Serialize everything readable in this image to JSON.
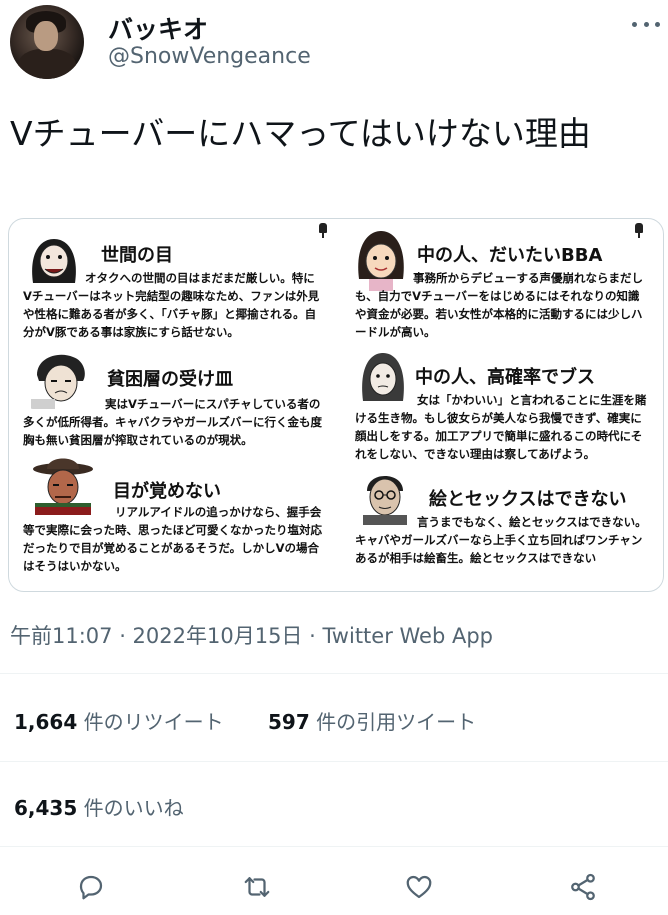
{
  "user": {
    "display_name": "バッキオ",
    "handle": "@SnowVengeance"
  },
  "tweet": {
    "text": "Vチューバーにハマってはいけない理由",
    "meta": "午前11:07 · 2022年10月15日 · Twitter Web App"
  },
  "media": {
    "cells": [
      {
        "title": "世間の目",
        "body": "オタクへの世間の目はまだまだ厳しい。特にVチューバーはネット完結型の趣味なため、ファンは外見や性格に難ある者が多く、「バチャ豚」と揶揄される。自分がV豚である事は家族にすら話せない。"
      },
      {
        "title": "中の人、だいたいBBA",
        "body": "事務所からデビューする声優崩れならまだしも、自力でVチューバーをはじめるにはそれなりの知識や資金が必要。若い女性が本格的に活動するには少しハードルが高い。"
      },
      {
        "title": "貧困層の受け皿",
        "body": "実はVチューバーにスパチャしている者の多くが低所得者。キャバクラやガールズバーに行く金も度胸も無い貧困層が搾取されているのが現状。"
      },
      {
        "title": "中の人、高確率でブス",
        "body": "女は「かわいい」と言われることに生涯を賭ける生き物。もし彼女らが美人なら我慢できず、確実に顔出しをする。加工アプリで簡単に盛れるこの時代にそれをしない、できない理由は察してあげよう。"
      },
      {
        "title": "目が覚めない",
        "body": "リアルアイドルの追っかけなら、握手会等で実際に会った時、思ったほど可愛くなかったり塩対応だったりで目が覚めることがあるそうだ。しかしVの場合はそうはいかない。"
      },
      {
        "title": "絵とセックスはできない",
        "body": "言うまでもなく、絵とセックスはできない。キャバやガールズバーなら上手く立ち回ればワンチャンあるが相手は絵畜生。絵とセックスはできない"
      }
    ]
  },
  "stats": {
    "retweets_count": "1,664",
    "retweets_label": "件のリツイート",
    "quotes_count": "597",
    "quotes_label": "件の引用ツイート",
    "likes_count": "6,435",
    "likes_label": "件のいいね"
  },
  "actions": {
    "reply_icon": "reply-icon",
    "retweet_icon": "retweet-icon",
    "like_icon": "heart-icon",
    "share_icon": "share-icon"
  },
  "colors": {
    "text": "#0f1419",
    "secondary": "#536471",
    "divider": "#eff3f4"
  }
}
